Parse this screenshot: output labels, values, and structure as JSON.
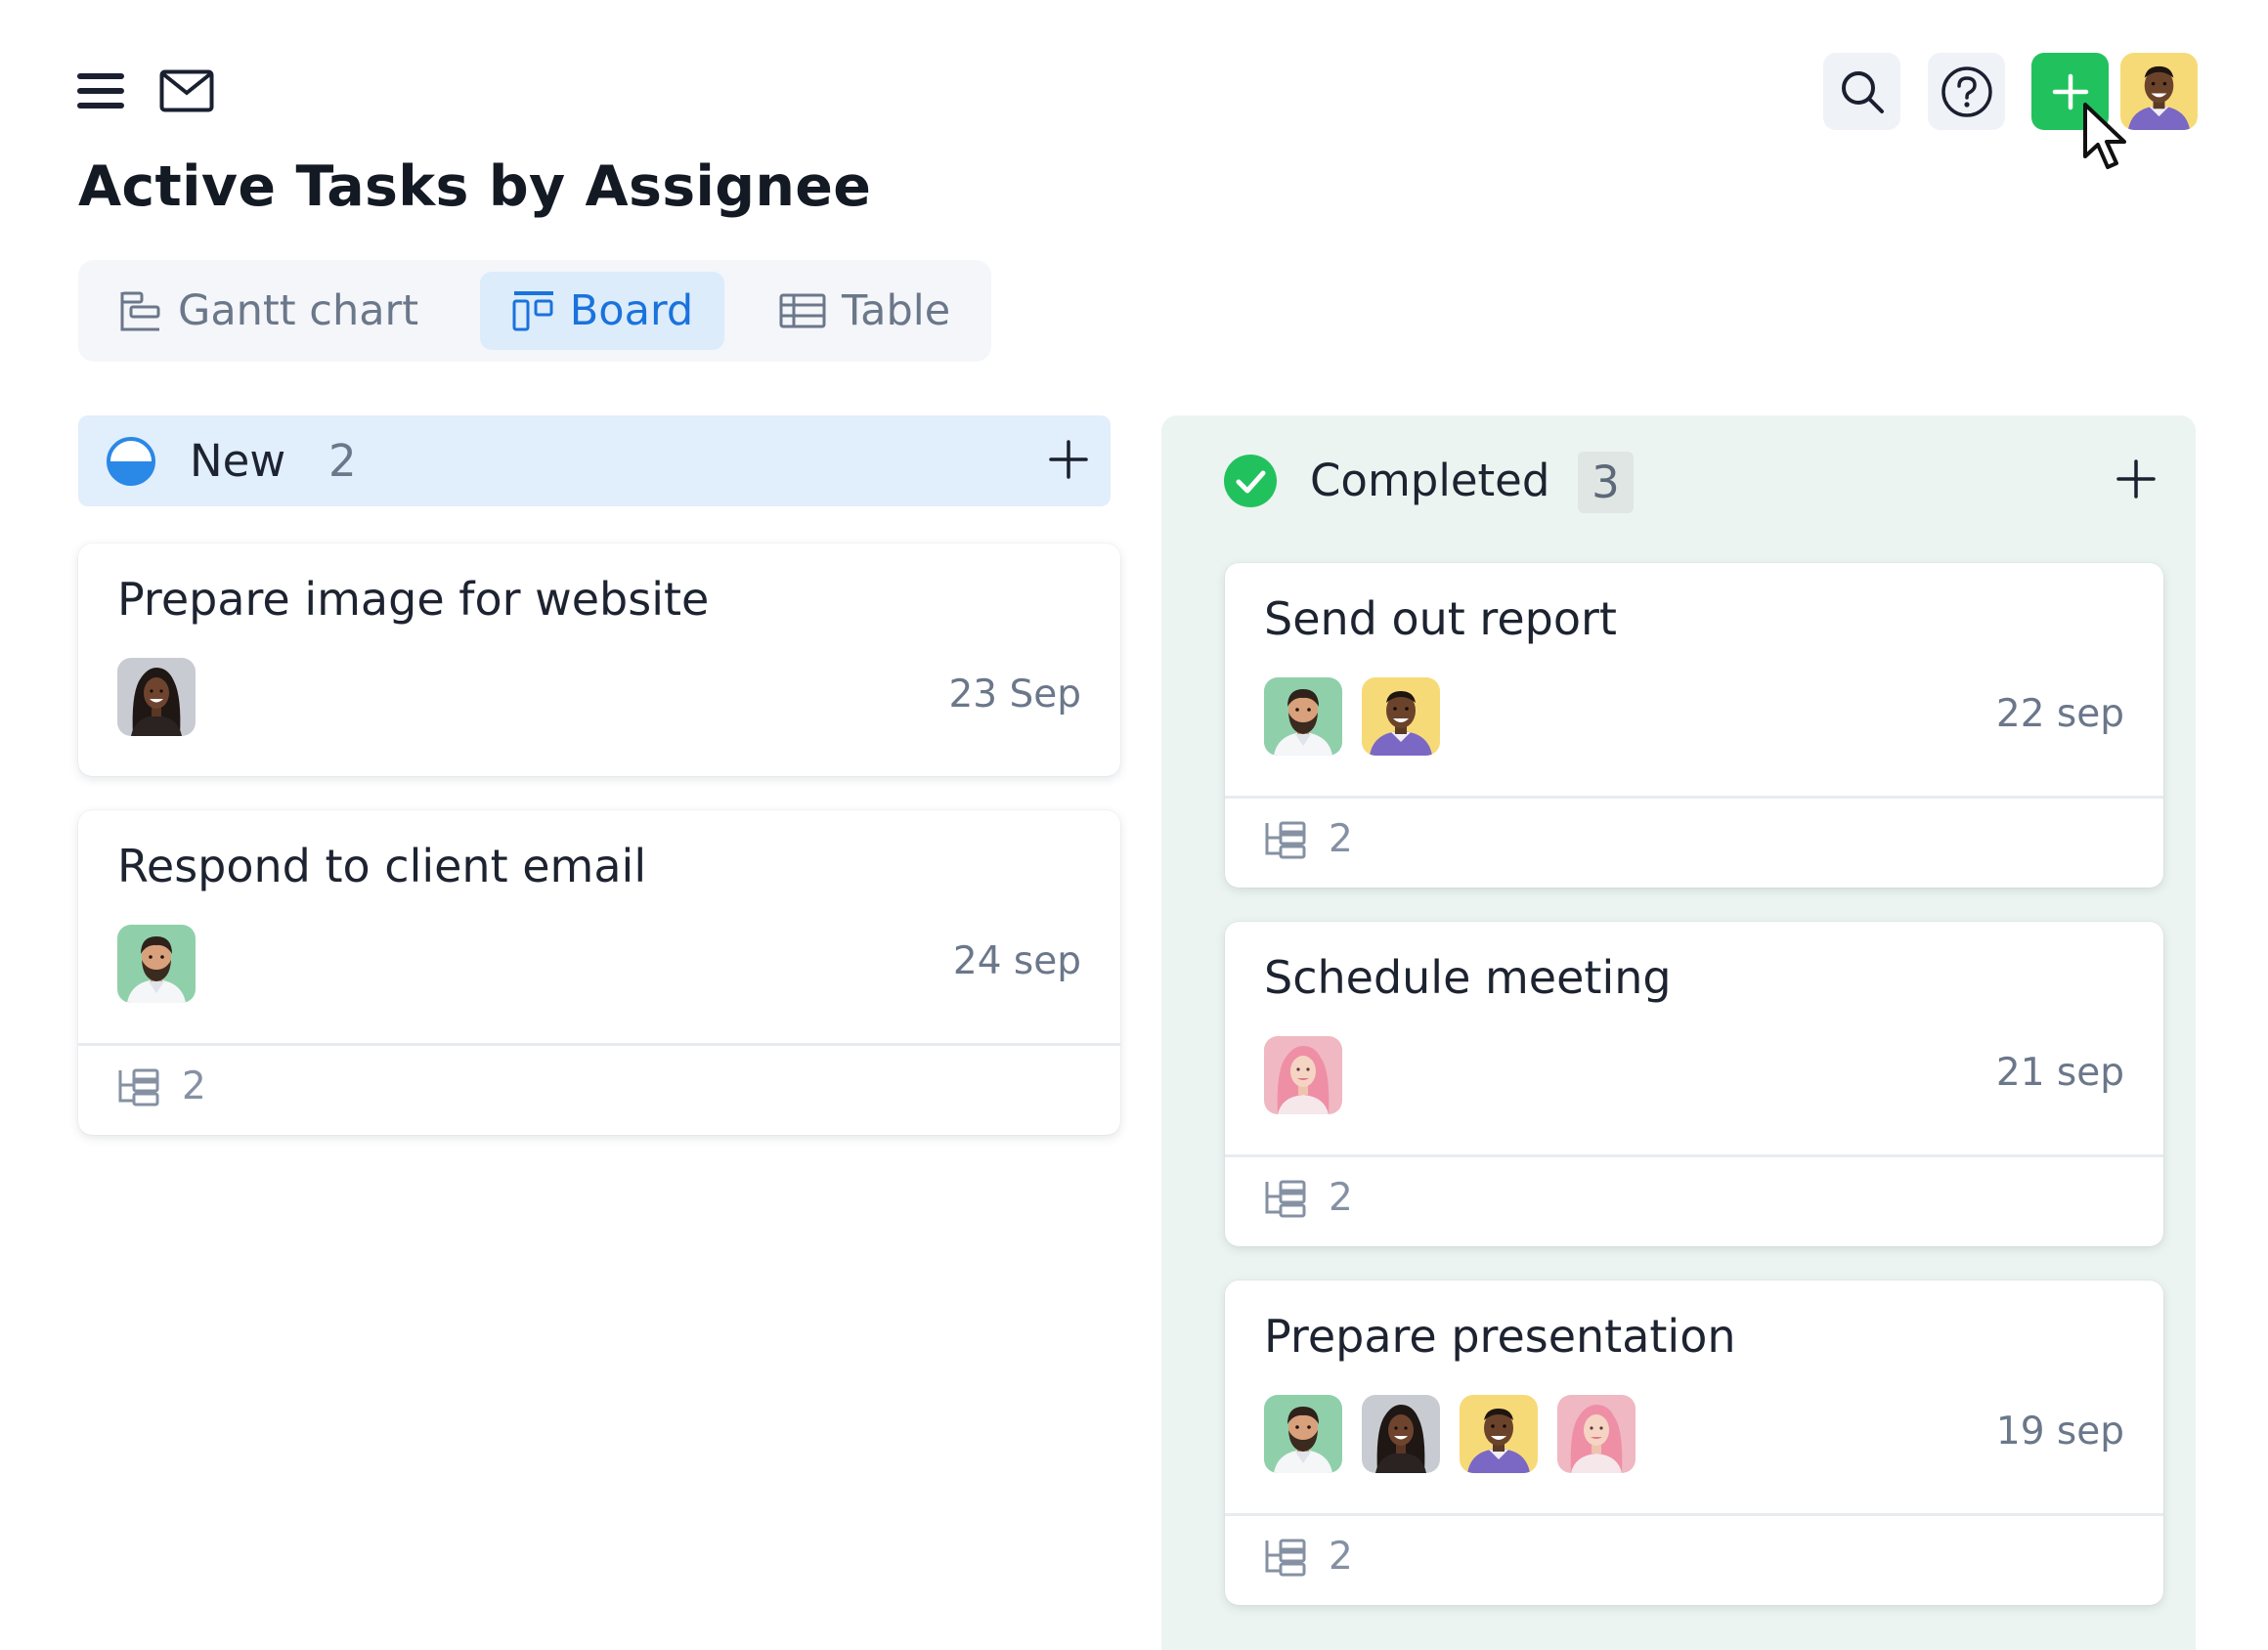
{
  "header": {
    "title": "Active Tasks by Assignee",
    "icons": [
      "menu-icon",
      "mail-icon",
      "search-icon",
      "help-icon",
      "plus-icon"
    ]
  },
  "views": [
    {
      "label": "Gantt chart",
      "icon": "gantt-icon",
      "active": false
    },
    {
      "label": "Board",
      "icon": "board-icon",
      "active": true
    },
    {
      "label": "Table",
      "icon": "table-icon",
      "active": false
    }
  ],
  "colors": {
    "accent_blue": "#1a72dc",
    "add_green": "#21c25e",
    "new_column_bg": "#e1eefb",
    "completed_column_bg": "#ecf4f1"
  },
  "columns": [
    {
      "title": "New",
      "count": "2",
      "status_icon": "half-circle-status-icon",
      "cards": [
        {
          "title": "Prepare image for website",
          "date": "23 Sep",
          "assignees": [
            "woman-dark-hair"
          ],
          "subtasks": null
        },
        {
          "title": "Respond to client email",
          "date": "24 sep",
          "assignees": [
            "man-beard"
          ],
          "subtasks": "2"
        }
      ]
    },
    {
      "title": "Completed",
      "count": "3",
      "status_icon": "check-circle-icon",
      "cards": [
        {
          "title": "Send out report",
          "date": "22 sep",
          "assignees": [
            "man-beard",
            "man-smiling"
          ],
          "subtasks": "2"
        },
        {
          "title": "Schedule meeting",
          "date": "21 sep",
          "assignees": [
            "woman-pink-hair"
          ],
          "subtasks": "2"
        },
        {
          "title": "Prepare presentation",
          "date": "19 sep",
          "assignees": [
            "man-beard",
            "woman-dark-hair",
            "man-smiling",
            "woman-pink-hair"
          ],
          "subtasks": "2"
        }
      ]
    }
  ]
}
